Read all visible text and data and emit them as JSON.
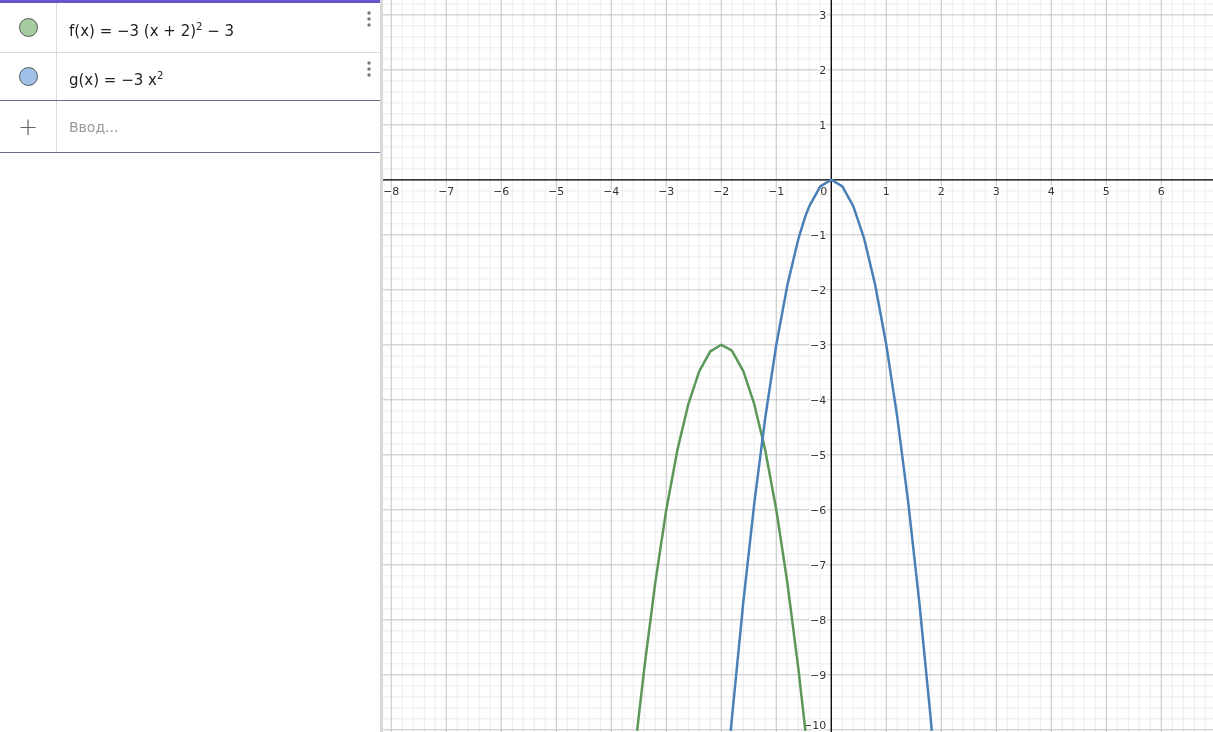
{
  "algebra": {
    "items": [
      {
        "label": "f(x) = −3 (x + 2)$^{2}$ − 3",
        "color": "#a6cba1"
      },
      {
        "label": "g(x) = −3 x$^{2}$",
        "color": "#9fc0e8"
      }
    ],
    "input": {
      "icon": "+",
      "placeholder": "Ввод..."
    }
  },
  "graphics": {
    "origin_label": "0",
    "chart_data": {
      "type": "line",
      "grid": true,
      "xlim": [
        -8.15,
        6.94
      ],
      "ylim": [
        -10.04,
        3.27
      ],
      "xticks": [
        {
          "value": -8,
          "label": "−8"
        },
        {
          "value": -7,
          "label": "−7"
        },
        {
          "value": -6,
          "label": "−6"
        },
        {
          "value": -5,
          "label": "−5"
        },
        {
          "value": -4,
          "label": "−4"
        },
        {
          "value": -3,
          "label": "−3"
        },
        {
          "value": -2,
          "label": "−2"
        },
        {
          "value": -1,
          "label": "−1"
        },
        {
          "value": 1,
          "label": "1"
        },
        {
          "value": 2,
          "label": "2"
        },
        {
          "value": 3,
          "label": "3"
        },
        {
          "value": 4,
          "label": "4"
        },
        {
          "value": 5,
          "label": "5"
        },
        {
          "value": 6,
          "label": "6"
        }
      ],
      "yticks": [
        {
          "value": -10,
          "label": "−10"
        },
        {
          "value": -9,
          "label": "−9"
        },
        {
          "value": -8,
          "label": "−8"
        },
        {
          "value": -7,
          "label": "−7"
        },
        {
          "value": -6,
          "label": "−6"
        },
        {
          "value": -5,
          "label": "−5"
        },
        {
          "value": -4,
          "label": "−4"
        },
        {
          "value": -3,
          "label": "−3"
        },
        {
          "value": -2,
          "label": "−2"
        },
        {
          "value": -1,
          "label": "−1"
        },
        {
          "value": 1,
          "label": "1"
        },
        {
          "value": 2,
          "label": "2"
        },
        {
          "value": 3,
          "label": "3"
        }
      ],
      "x": [
        -3.53,
        -3.4,
        -3.2,
        -3.0,
        -2.8,
        -2.6,
        -2.4,
        -2.2,
        -2.0,
        -1.828,
        -1.8,
        -1.6,
        -1.4,
        -1.2,
        -1.0,
        -0.8,
        -0.6,
        -0.47,
        -0.4,
        -0.2,
        0,
        0.2,
        0.4,
        0.6,
        0.8,
        1.0,
        1.2,
        1.4,
        1.6,
        1.8,
        1.828
      ],
      "series": [
        {
          "color": "#5b9857",
          "values": [
            -10.02,
            -8.88,
            -7.32,
            -6,
            -4.92,
            -4.08,
            -3.48,
            -3.12,
            -3,
            -3.09,
            -3.12,
            -3.48,
            -4.08,
            -4.92,
            -6,
            -7.32,
            -8.88,
            -10.02,
            null,
            null,
            null,
            null,
            null,
            null,
            null,
            null,
            null,
            null,
            null,
            null,
            null
          ]
        },
        {
          "color": "#4a80b8",
          "values": [
            null,
            null,
            null,
            null,
            null,
            null,
            null,
            null,
            null,
            -10.02,
            -9.72,
            -7.68,
            -5.88,
            -4.32,
            -3,
            -1.92,
            -1.08,
            -0.66,
            -0.48,
            -0.12,
            0,
            -0.12,
            -0.48,
            -1.08,
            -1.92,
            -3,
            -4.32,
            -5.88,
            -7.68,
            -9.72,
            -10.02
          ]
        }
      ]
    }
  }
}
